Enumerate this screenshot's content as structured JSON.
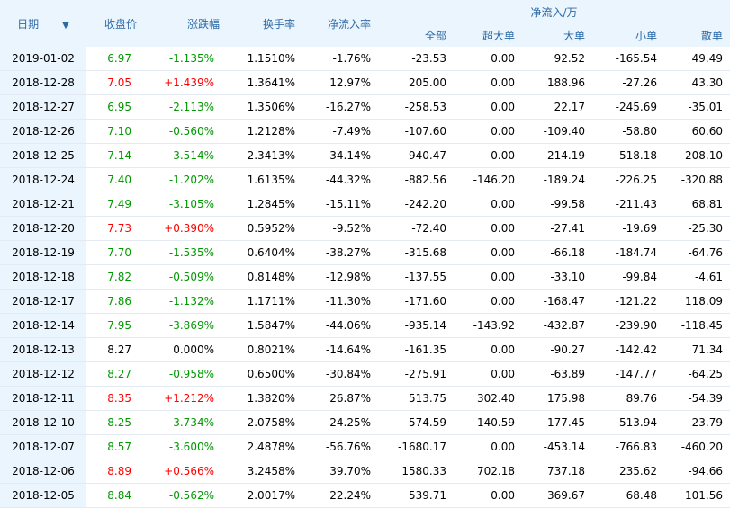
{
  "headers": {
    "date": "日期",
    "close": "收盘价",
    "change": "涨跌幅",
    "turnover": "换手率",
    "net_ratio": "净流入率",
    "net_inflow": "净流入/万",
    "total": "全部",
    "super_large": "超大单",
    "large": "大单",
    "small": "小单",
    "retail": "散单"
  },
  "rows": [
    {
      "date": "2019-01-02",
      "close": "6.97",
      "change": "-1.135%",
      "turnover": "1.1510%",
      "net_ratio": "-1.76%",
      "total": "-23.53",
      "super_large": "0.00",
      "large": "92.52",
      "small": "-165.54",
      "retail": "49.49",
      "dir": "down"
    },
    {
      "date": "2018-12-28",
      "close": "7.05",
      "change": "+1.439%",
      "turnover": "1.3641%",
      "net_ratio": "12.97%",
      "total": "205.00",
      "super_large": "0.00",
      "large": "188.96",
      "small": "-27.26",
      "retail": "43.30",
      "dir": "up"
    },
    {
      "date": "2018-12-27",
      "close": "6.95",
      "change": "-2.113%",
      "turnover": "1.3506%",
      "net_ratio": "-16.27%",
      "total": "-258.53",
      "super_large": "0.00",
      "large": "22.17",
      "small": "-245.69",
      "retail": "-35.01",
      "dir": "down"
    },
    {
      "date": "2018-12-26",
      "close": "7.10",
      "change": "-0.560%",
      "turnover": "1.2128%",
      "net_ratio": "-7.49%",
      "total": "-107.60",
      "super_large": "0.00",
      "large": "-109.40",
      "small": "-58.80",
      "retail": "60.60",
      "dir": "down"
    },
    {
      "date": "2018-12-25",
      "close": "7.14",
      "change": "-3.514%",
      "turnover": "2.3413%",
      "net_ratio": "-34.14%",
      "total": "-940.47",
      "super_large": "0.00",
      "large": "-214.19",
      "small": "-518.18",
      "retail": "-208.10",
      "dir": "down"
    },
    {
      "date": "2018-12-24",
      "close": "7.40",
      "change": "-1.202%",
      "turnover": "1.6135%",
      "net_ratio": "-44.32%",
      "total": "-882.56",
      "super_large": "-146.20",
      "large": "-189.24",
      "small": "-226.25",
      "retail": "-320.88",
      "dir": "down"
    },
    {
      "date": "2018-12-21",
      "close": "7.49",
      "change": "-3.105%",
      "turnover": "1.2845%",
      "net_ratio": "-15.11%",
      "total": "-242.20",
      "super_large": "0.00",
      "large": "-99.58",
      "small": "-211.43",
      "retail": "68.81",
      "dir": "down"
    },
    {
      "date": "2018-12-20",
      "close": "7.73",
      "change": "+0.390%",
      "turnover": "0.5952%",
      "net_ratio": "-9.52%",
      "total": "-72.40",
      "super_large": "0.00",
      "large": "-27.41",
      "small": "-19.69",
      "retail": "-25.30",
      "dir": "up"
    },
    {
      "date": "2018-12-19",
      "close": "7.70",
      "change": "-1.535%",
      "turnover": "0.6404%",
      "net_ratio": "-38.27%",
      "total": "-315.68",
      "super_large": "0.00",
      "large": "-66.18",
      "small": "-184.74",
      "retail": "-64.76",
      "dir": "down"
    },
    {
      "date": "2018-12-18",
      "close": "7.82",
      "change": "-0.509%",
      "turnover": "0.8148%",
      "net_ratio": "-12.98%",
      "total": "-137.55",
      "super_large": "0.00",
      "large": "-33.10",
      "small": "-99.84",
      "retail": "-4.61",
      "dir": "down"
    },
    {
      "date": "2018-12-17",
      "close": "7.86",
      "change": "-1.132%",
      "turnover": "1.1711%",
      "net_ratio": "-11.30%",
      "total": "-171.60",
      "super_large": "0.00",
      "large": "-168.47",
      "small": "-121.22",
      "retail": "118.09",
      "dir": "down"
    },
    {
      "date": "2018-12-14",
      "close": "7.95",
      "change": "-3.869%",
      "turnover": "1.5847%",
      "net_ratio": "-44.06%",
      "total": "-935.14",
      "super_large": "-143.92",
      "large": "-432.87",
      "small": "-239.90",
      "retail": "-118.45",
      "dir": "down"
    },
    {
      "date": "2018-12-13",
      "close": "8.27",
      "change": "0.000%",
      "turnover": "0.8021%",
      "net_ratio": "-14.64%",
      "total": "-161.35",
      "super_large": "0.00",
      "large": "-90.27",
      "small": "-142.42",
      "retail": "71.34",
      "dir": "flat"
    },
    {
      "date": "2018-12-12",
      "close": "8.27",
      "change": "-0.958%",
      "turnover": "0.6500%",
      "net_ratio": "-30.84%",
      "total": "-275.91",
      "super_large": "0.00",
      "large": "-63.89",
      "small": "-147.77",
      "retail": "-64.25",
      "dir": "down"
    },
    {
      "date": "2018-12-11",
      "close": "8.35",
      "change": "+1.212%",
      "turnover": "1.3820%",
      "net_ratio": "26.87%",
      "total": "513.75",
      "super_large": "302.40",
      "large": "175.98",
      "small": "89.76",
      "retail": "-54.39",
      "dir": "up"
    },
    {
      "date": "2018-12-10",
      "close": "8.25",
      "change": "-3.734%",
      "turnover": "2.0758%",
      "net_ratio": "-24.25%",
      "total": "-574.59",
      "super_large": "140.59",
      "large": "-177.45",
      "small": "-513.94",
      "retail": "-23.79",
      "dir": "down"
    },
    {
      "date": "2018-12-07",
      "close": "8.57",
      "change": "-3.600%",
      "turnover": "2.4878%",
      "net_ratio": "-56.76%",
      "total": "-1680.17",
      "super_large": "0.00",
      "large": "-453.14",
      "small": "-766.83",
      "retail": "-460.20",
      "dir": "down"
    },
    {
      "date": "2018-12-06",
      "close": "8.89",
      "change": "+0.566%",
      "turnover": "3.2458%",
      "net_ratio": "39.70%",
      "total": "1580.33",
      "super_large": "702.18",
      "large": "737.18",
      "small": "235.62",
      "retail": "-94.66",
      "dir": "up"
    },
    {
      "date": "2018-12-05",
      "close": "8.84",
      "change": "-0.562%",
      "turnover": "2.0017%",
      "net_ratio": "22.24%",
      "total": "539.71",
      "super_large": "0.00",
      "large": "369.67",
      "small": "68.48",
      "retail": "101.56",
      "dir": "down"
    }
  ],
  "colors": {
    "up": "#ff0000",
    "down": "#009900",
    "flat": "#000000",
    "header_bg": "#ebf5fe",
    "header_text": "#2d6aa5"
  }
}
